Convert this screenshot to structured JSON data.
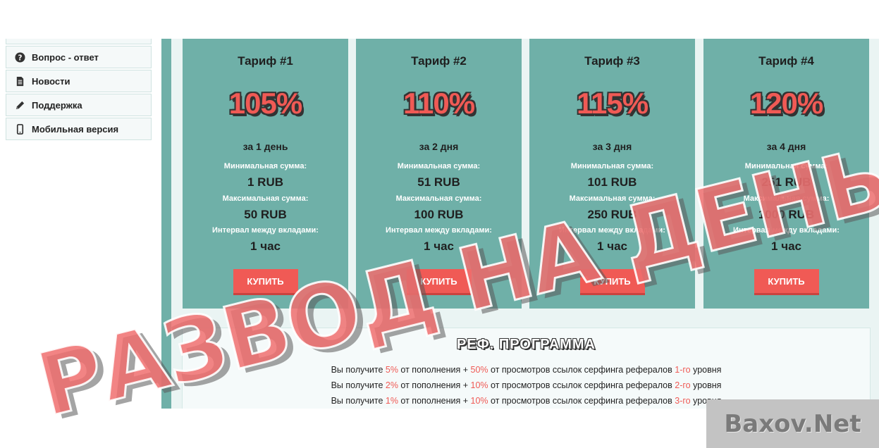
{
  "sidebar": {
    "items": [
      {
        "label": "Вопрос - ответ",
        "icon": "question-circle-icon"
      },
      {
        "label": "Новости",
        "icon": "document-icon"
      },
      {
        "label": "Поддержка",
        "icon": "pencil-icon"
      },
      {
        "label": "Мобильная версия",
        "icon": "mobile-phone-icon"
      }
    ]
  },
  "tariffs": [
    {
      "title": "Тариф #1",
      "percent": "105%",
      "period": "за 1 день",
      "min_label": "Минимальная сумма:",
      "min": "1 RUB",
      "max_label": "Максимальная сумма:",
      "max": "50 RUB",
      "interval_label": "Интервал между вкладами:",
      "interval": "1 час",
      "buy_label": "КУПИТЬ"
    },
    {
      "title": "Тариф #2",
      "percent": "110%",
      "period": "за 2 дня",
      "min_label": "Минимальная сумма:",
      "min": "51 RUB",
      "max_label": "Максимальная сумма:",
      "max": "100 RUB",
      "interval_label": "Интервал между вкладами:",
      "interval": "1 час",
      "buy_label": "КУПИТЬ"
    },
    {
      "title": "Тариф #3",
      "percent": "115%",
      "period": "за 3 дня",
      "min_label": "Минимальная сумма:",
      "min": "101 RUB",
      "max_label": "Максимальная сумма:",
      "max": "250 RUB",
      "interval_label": "Интервал между вкладами:",
      "interval": "1 час",
      "buy_label": "КУПИТЬ"
    },
    {
      "title": "Тариф #4",
      "percent": "120%",
      "period": "за 4 дня",
      "min_label": "Минимальная сумма:",
      "min": "251 RUB",
      "max_label": "Максимальная сумма:",
      "max": "1000 RUB",
      "interval_label": "Интервал между вкладами:",
      "interval": "1 час",
      "buy_label": "КУПИТЬ"
    }
  ],
  "referral": {
    "title": "РЕФ. ПРОГРАММА",
    "lines": [
      {
        "p1": "Вы получите ",
        "pct1": "5%",
        "p2": " от пополнения + ",
        "pct2": "50%",
        "p3": " от просмотров ссылок серфинга рефералов ",
        "lvl": "1-го",
        "p4": " уровня"
      },
      {
        "p1": "Вы получите ",
        "pct1": "2%",
        "p2": " от пополнения + ",
        "pct2": "10%",
        "p3": " от просмотров ссылок серфинга рефералов ",
        "lvl": "2-го",
        "p4": " уровня"
      },
      {
        "p1": "Вы получите ",
        "pct1": "1%",
        "p2": " от пополнения + ",
        "pct2": "10%",
        "p3": " от просмотров ссылок серфинга рефералов ",
        "lvl": "3-го",
        "p4": " уровня"
      }
    ]
  },
  "watermark": {
    "text": "РАЗВОД НА ДЕНЬГИ"
  },
  "site_badge": {
    "text": "Baxov.Net"
  },
  "colors": {
    "accent": "#f05a55",
    "card": "#6fb0a8",
    "panel": "#eaf4f3"
  }
}
